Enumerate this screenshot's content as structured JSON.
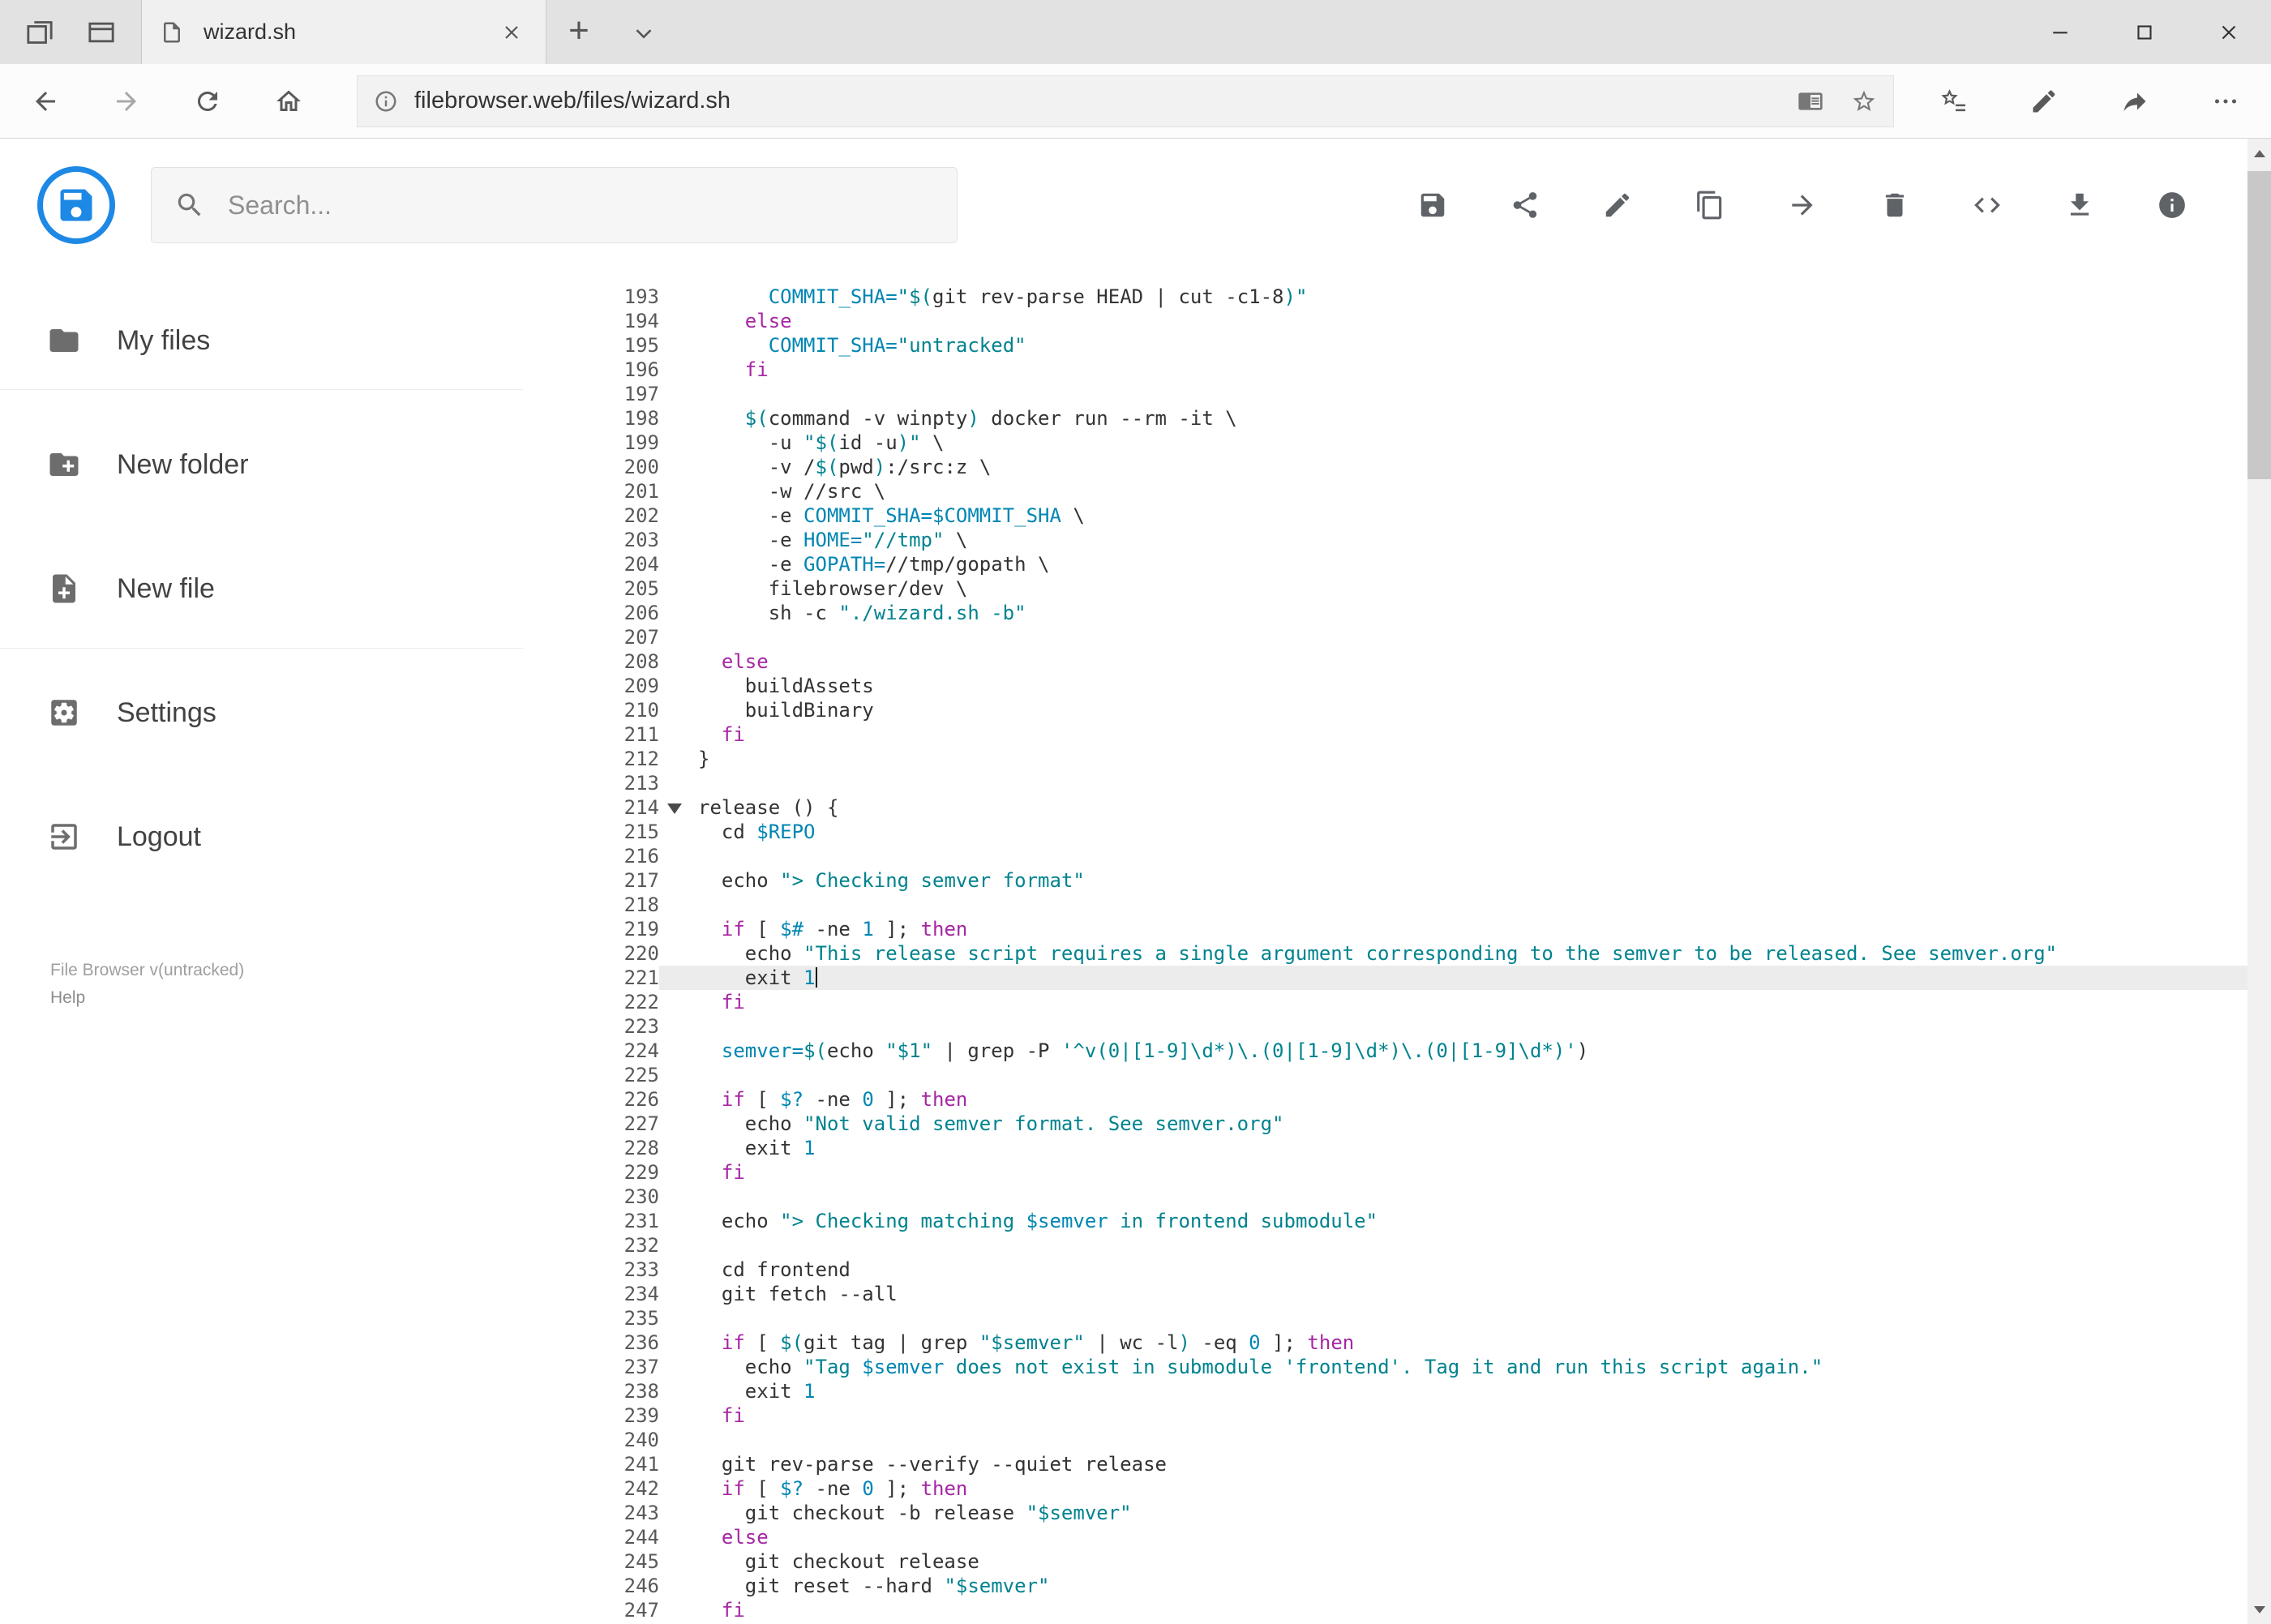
{
  "browser": {
    "tab_title": "wizard.sh",
    "url": "filebrowser.web/files/wizard.sh",
    "window_controls": [
      "minimize",
      "maximize",
      "close"
    ]
  },
  "app": {
    "search": {
      "placeholder": "Search...",
      "value": ""
    },
    "toolbar": {
      "icons": [
        "save",
        "share",
        "edit",
        "copy",
        "move",
        "delete",
        "raw",
        "download",
        "info"
      ]
    },
    "sidebar": {
      "items": [
        {
          "icon": "folder",
          "label": "My files"
        },
        {
          "icon": "new-folder",
          "label": "New folder"
        },
        {
          "icon": "new-file",
          "label": "New file"
        },
        {
          "icon": "settings",
          "label": "Settings"
        },
        {
          "icon": "logout",
          "label": "Logout"
        }
      ],
      "footer": {
        "version": "File Browser v(untracked)",
        "help": "Help"
      }
    }
  },
  "editor": {
    "first_line": 193,
    "active_line": 221,
    "folded_lines": [
      214
    ],
    "lines": [
      [
        [
          "p",
          "      "
        ],
        [
          "v",
          "COMMIT_SHA="
        ],
        [
          "s",
          "\"$("
        ],
        [
          "p",
          "git rev-parse HEAD | cut -c1-8"
        ],
        [
          "s",
          ")\""
        ]
      ],
      [
        [
          "p",
          "    "
        ],
        [
          "k",
          "else"
        ]
      ],
      [
        [
          "p",
          "      "
        ],
        [
          "v",
          "COMMIT_SHA="
        ],
        [
          "s",
          "\"untracked\""
        ]
      ],
      [
        [
          "p",
          "    "
        ],
        [
          "k",
          "fi"
        ]
      ],
      [],
      [
        [
          "p",
          "    "
        ],
        [
          "s",
          "$("
        ],
        [
          "p",
          "command -v winpty"
        ],
        [
          "s",
          ")"
        ],
        [
          "p",
          " docker run --rm -it \\"
        ]
      ],
      [
        [
          "p",
          "      -u "
        ],
        [
          "s",
          "\"$("
        ],
        [
          "p",
          "id -u"
        ],
        [
          "s",
          ")\""
        ],
        [
          "p",
          " \\"
        ]
      ],
      [
        [
          "p",
          "      -v /"
        ],
        [
          "s",
          "$("
        ],
        [
          "p",
          "pwd"
        ],
        [
          "s",
          ")"
        ],
        [
          "p",
          ":/src:z \\"
        ]
      ],
      [
        [
          "p",
          "      -w //src \\"
        ]
      ],
      [
        [
          "p",
          "      -e "
        ],
        [
          "v",
          "COMMIT_SHA=$COMMIT_SHA"
        ],
        [
          "p",
          " \\"
        ]
      ],
      [
        [
          "p",
          "      -e "
        ],
        [
          "v",
          "HOME="
        ],
        [
          "s",
          "\"//tmp\""
        ],
        [
          "p",
          " \\"
        ]
      ],
      [
        [
          "p",
          "      -e "
        ],
        [
          "v",
          "GOPATH="
        ],
        [
          "p",
          "//tmp/gopath \\"
        ]
      ],
      [
        [
          "p",
          "      filebrowser/dev \\"
        ]
      ],
      [
        [
          "p",
          "      sh -c "
        ],
        [
          "s",
          "\"./wizard.sh -b\""
        ]
      ],
      [],
      [
        [
          "p",
          "  "
        ],
        [
          "k",
          "else"
        ]
      ],
      [
        [
          "p",
          "    buildAssets"
        ]
      ],
      [
        [
          "p",
          "    buildBinary"
        ]
      ],
      [
        [
          "p",
          "  "
        ],
        [
          "k",
          "fi"
        ]
      ],
      [
        [
          "p",
          "}"
        ]
      ],
      [],
      [
        [
          "p",
          "release () {"
        ]
      ],
      [
        [
          "p",
          "  cd "
        ],
        [
          "v",
          "$REPO"
        ]
      ],
      [],
      [
        [
          "p",
          "  echo "
        ],
        [
          "s",
          "\"> Checking semver format\""
        ]
      ],
      [],
      [
        [
          "p",
          "  "
        ],
        [
          "k",
          "if"
        ],
        [
          "p",
          " [ "
        ],
        [
          "v",
          "$#"
        ],
        [
          "p",
          " -ne "
        ],
        [
          "n",
          "1"
        ],
        [
          "p",
          " ]; "
        ],
        [
          "k",
          "then"
        ]
      ],
      [
        [
          "p",
          "    echo "
        ],
        [
          "s",
          "\"This release script requires a single argument corresponding to the semver to be released. See semver.org\""
        ]
      ],
      [
        [
          "p",
          "    exit "
        ],
        [
          "n",
          "1"
        ]
      ],
      [
        [
          "p",
          "  "
        ],
        [
          "k",
          "fi"
        ]
      ],
      [],
      [
        [
          "p",
          "  "
        ],
        [
          "v",
          "semver="
        ],
        [
          "s",
          "$("
        ],
        [
          "p",
          "echo "
        ],
        [
          "s",
          "\"$1\""
        ],
        [
          "p",
          " | grep -P "
        ],
        [
          "s",
          "'^v(0|[1-9]\\d*)\\.(0|[1-9]\\d*)\\.(0|[1-9]\\d*)'"
        ],
        [
          "p",
          ")"
        ]
      ],
      [],
      [
        [
          "p",
          "  "
        ],
        [
          "k",
          "if"
        ],
        [
          "p",
          " [ "
        ],
        [
          "v",
          "$?"
        ],
        [
          "p",
          " -ne "
        ],
        [
          "n",
          "0"
        ],
        [
          "p",
          " ]; "
        ],
        [
          "k",
          "then"
        ]
      ],
      [
        [
          "p",
          "    echo "
        ],
        [
          "s",
          "\"Not valid semver format. See semver.org\""
        ]
      ],
      [
        [
          "p",
          "    exit "
        ],
        [
          "n",
          "1"
        ]
      ],
      [
        [
          "p",
          "  "
        ],
        [
          "k",
          "fi"
        ]
      ],
      [],
      [
        [
          "p",
          "  echo "
        ],
        [
          "s",
          "\"> Checking matching "
        ],
        [
          "v",
          "$semver"
        ],
        [
          "s",
          " in frontend submodule\""
        ]
      ],
      [],
      [
        [
          "p",
          "  cd frontend"
        ]
      ],
      [
        [
          "p",
          "  git fetch --all"
        ]
      ],
      [],
      [
        [
          "p",
          "  "
        ],
        [
          "k",
          "if"
        ],
        [
          "p",
          " [ "
        ],
        [
          "s",
          "$("
        ],
        [
          "p",
          "git tag | grep "
        ],
        [
          "s",
          "\"$semver\""
        ],
        [
          "p",
          " | wc -l"
        ],
        [
          "s",
          ")"
        ],
        [
          "p",
          " -eq "
        ],
        [
          "n",
          "0"
        ],
        [
          "p",
          " ]; "
        ],
        [
          "k",
          "then"
        ]
      ],
      [
        [
          "p",
          "    echo "
        ],
        [
          "s",
          "\"Tag "
        ],
        [
          "v",
          "$semver"
        ],
        [
          "s",
          " does not exist in submodule 'frontend'. Tag it and run this script again.\""
        ]
      ],
      [
        [
          "p",
          "    exit "
        ],
        [
          "n",
          "1"
        ]
      ],
      [
        [
          "p",
          "  "
        ],
        [
          "k",
          "fi"
        ]
      ],
      [],
      [
        [
          "p",
          "  git rev-parse --verify --quiet release"
        ]
      ],
      [
        [
          "p",
          "  "
        ],
        [
          "k",
          "if"
        ],
        [
          "p",
          " [ "
        ],
        [
          "v",
          "$?"
        ],
        [
          "p",
          " -ne "
        ],
        [
          "n",
          "0"
        ],
        [
          "p",
          " ]; "
        ],
        [
          "k",
          "then"
        ]
      ],
      [
        [
          "p",
          "    git checkout -b release "
        ],
        [
          "s",
          "\"$semver\""
        ]
      ],
      [
        [
          "p",
          "  "
        ],
        [
          "k",
          "else"
        ]
      ],
      [
        [
          "p",
          "    git checkout release"
        ]
      ],
      [
        [
          "p",
          "    git reset --hard "
        ],
        [
          "s",
          "\"$semver\""
        ]
      ],
      [
        [
          "p",
          "  "
        ],
        [
          "k",
          "fi"
        ]
      ]
    ]
  },
  "colors": {
    "accent": "#1e88e5",
    "keyword": "#a626a4",
    "string": "#00838f",
    "variable": "#0086b3",
    "number": "#0086b3",
    "active_line_bg": "#ececec"
  }
}
